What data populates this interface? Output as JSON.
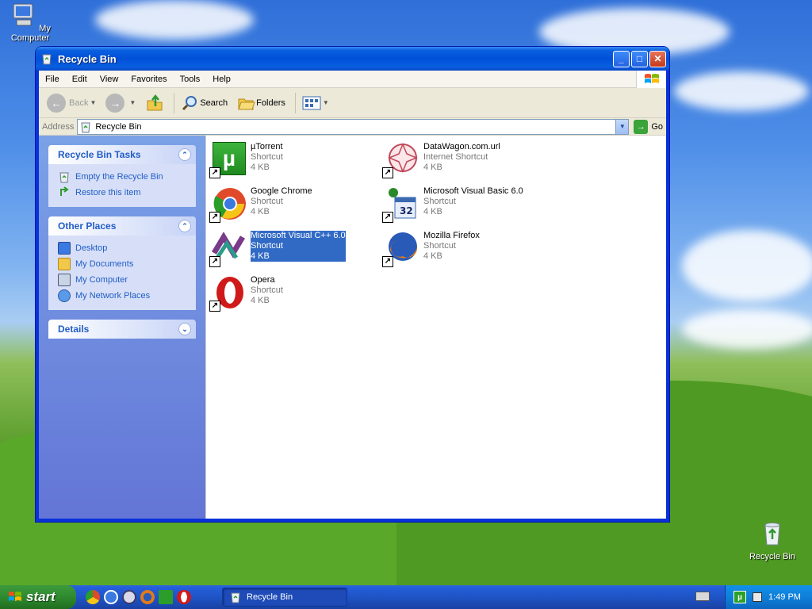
{
  "desktop": {
    "my_computer_label": "My Computer",
    "recycle_bin_label": "Recycle Bin"
  },
  "window": {
    "title": "Recycle Bin",
    "minimize_glyph": "_",
    "maximize_glyph": "□",
    "close_glyph": "✕"
  },
  "menu": {
    "items": [
      "File",
      "Edit",
      "View",
      "Favorites",
      "Tools",
      "Help"
    ]
  },
  "toolbar": {
    "back_label": "Back",
    "search_label": "Search",
    "folders_label": "Folders"
  },
  "address": {
    "label": "Address",
    "value": "Recycle Bin",
    "go_label": "Go"
  },
  "tasks": {
    "recycle_panel_title": "Recycle Bin Tasks",
    "recycle_links": [
      "Empty the Recycle Bin",
      "Restore this item"
    ],
    "places_panel_title": "Other Places",
    "places_links": [
      "Desktop",
      "My Documents",
      "My Computer",
      "My Network Places"
    ],
    "details_panel_title": "Details"
  },
  "files": [
    {
      "name": "µTorrent",
      "type": "Shortcut",
      "size": "4 KB",
      "icon": "utorrent-icon",
      "color": "#2a9d2a"
    },
    {
      "name": "DataWagon.com.url",
      "type": "Internet Shortcut",
      "size": "4 KB",
      "icon": "url-icon",
      "color": "#c0485a"
    },
    {
      "name": "Google Chrome",
      "type": "Shortcut",
      "size": "4 KB",
      "icon": "chrome-icon",
      "color": "#e04a2a"
    },
    {
      "name": "Microsoft Visual Basic 6.0",
      "type": "Shortcut",
      "size": "4 KB",
      "icon": "vb6-icon",
      "color": "#3a6ab0"
    },
    {
      "name": "Microsoft Visual C++ 6.0",
      "type": "Shortcut",
      "size": "4 KB",
      "icon": "vcpp-icon",
      "color": "#7a3a8a",
      "selected": true
    },
    {
      "name": "Mozilla Firefox",
      "type": "Shortcut",
      "size": "4 KB",
      "icon": "firefox-icon",
      "color": "#e07a1a"
    },
    {
      "name": "Opera",
      "type": "Shortcut",
      "size": "4 KB",
      "icon": "opera-icon",
      "color": "#d01a1a"
    }
  ],
  "taskbar": {
    "start_label": "start",
    "task_label": "Recycle Bin",
    "clock": "1:49 PM"
  },
  "colors": {
    "xp_blue": "#0831d9",
    "task_link": "#215dc6",
    "selection": "#316ac5"
  }
}
